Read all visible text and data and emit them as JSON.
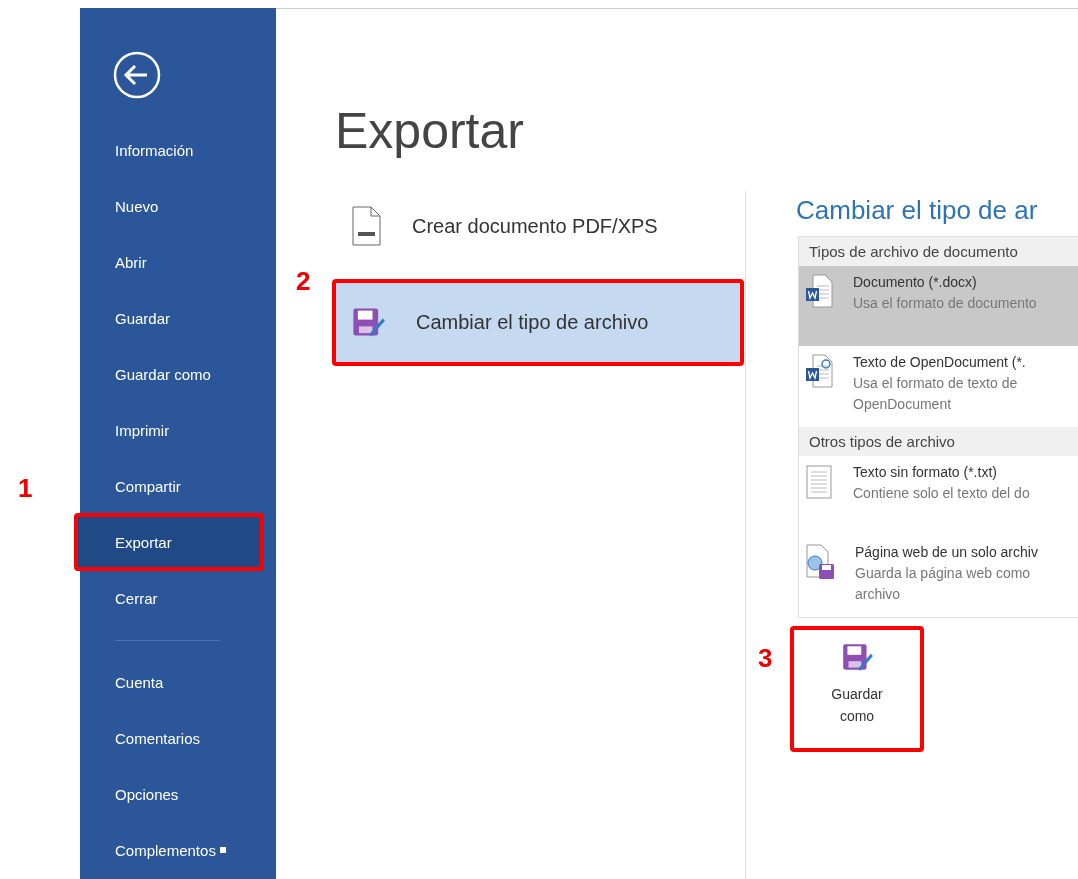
{
  "sidebar": {
    "items": [
      {
        "label": "Información",
        "selected": false
      },
      {
        "label": "Nuevo",
        "selected": false
      },
      {
        "label": "Abrir",
        "selected": false
      },
      {
        "label": "Guardar",
        "selected": false
      },
      {
        "label": "Guardar como",
        "selected": false
      },
      {
        "label": "Imprimir",
        "selected": false
      },
      {
        "label": "Compartir",
        "selected": false
      },
      {
        "label": "Exportar",
        "selected": true,
        "callout": "1"
      },
      {
        "label": "Cerrar",
        "selected": false
      }
    ],
    "footer_items": [
      {
        "label": "Cuenta",
        "selected": false
      },
      {
        "label": "Comentarios",
        "selected": false
      },
      {
        "label": "Opciones",
        "selected": false
      },
      {
        "label": "Complementos",
        "selected": false,
        "has_menu": true
      }
    ]
  },
  "main": {
    "title": "Exportar",
    "options": [
      {
        "label": "Crear documento PDF/XPS",
        "kind": "pdf",
        "selected": false
      },
      {
        "label": "Cambiar el tipo de archivo",
        "kind": "save",
        "selected": true,
        "callout": "2"
      }
    ],
    "panel": {
      "heading": "Cambiar el tipo de ar",
      "groups": [
        {
          "header": "Tipos de archivo de documento",
          "items": [
            {
              "name": "Documento (*.docx)",
              "description": "Usa el formato de documento",
              "kind": "word",
              "selected": true
            },
            {
              "name": "Texto de OpenDocument (*.",
              "description": "Usa el formato de texto de",
              "description_2": "OpenDocument",
              "kind": "odt",
              "selected": false
            }
          ]
        },
        {
          "header": "Otros tipos de archivo",
          "items": [
            {
              "name": "Texto sin formato (*.txt)",
              "description": "Contiene solo el texto del do",
              "kind": "text",
              "selected": false
            },
            {
              "name": "Página web de un solo archiv",
              "description": "Guarda la página web como",
              "description_2": "archivo",
              "kind": "web",
              "selected": false
            }
          ]
        }
      ],
      "save_button": {
        "label": "Guardar como",
        "callout": "3"
      }
    }
  }
}
